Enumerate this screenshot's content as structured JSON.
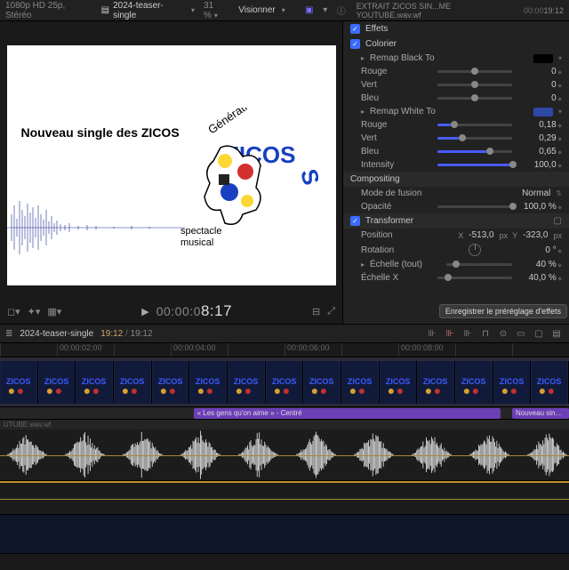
{
  "topbar": {
    "format": "1080p HD 25p, Stéréo",
    "project": "2024-teaser-single",
    "zoom": "31 %",
    "view_btn": "Visionner",
    "clip_name": "EXTRAIT ZICOS SIN...ME YOUTUBE.wav.wf",
    "clip_tc": "19:12"
  },
  "canvas": {
    "heading": "Nouveau single des ZICOS",
    "logo_word1": "Génération",
    "logo_word2": "ZICOS",
    "logo_sub1": "spectacle",
    "logo_sub2": "musical"
  },
  "transport": {
    "timecode_prefix": "00:00:0",
    "timecode_big": "8:17"
  },
  "inspector": {
    "effects": "Effets",
    "colorier": "Colorier",
    "remap_black": "Remap Black To",
    "remap_white": "Remap White To",
    "rouge": "Rouge",
    "vert": "Vert",
    "bleu": "Bleu",
    "intensity": "Intensity",
    "compositing": "Compositing",
    "blend": "Mode de fusion",
    "blend_val": "Normal",
    "opacity": "Opacité",
    "opacity_val": "100,0 %",
    "transformer": "Transformer",
    "position": "Position",
    "pos_x": "-513,0",
    "pos_y": "-323,0",
    "rotation": "Rotation",
    "rot_val": "0 °",
    "scale_all": "Échelle (tout)",
    "scale_all_val": "40 %",
    "scale_x": "Échelle X",
    "scale_x_val": "40,0 %",
    "rb_r": "0",
    "rb_g": "0",
    "rb_b": "0",
    "rw_r": "0,18",
    "rw_g": "0,29",
    "rw_b": "0,65",
    "rw_i": "100,0",
    "tooltip": "Enregistrer le préréglage d'effets"
  },
  "tl": {
    "project": "2024-teaser-single",
    "time": "19:12",
    "dur": "19:12",
    "ruler": [
      "",
      "00:00:02:00",
      "",
      "00:00:04:00",
      "",
      "00:00:06:00",
      "",
      "00:00:08:00",
      "",
      ""
    ],
    "title_clip": "« Les gens qu'on aime »  -  Centré",
    "title_clip2": "Nouveau sin...",
    "audio_label": "UTUBE.wav.wf"
  }
}
